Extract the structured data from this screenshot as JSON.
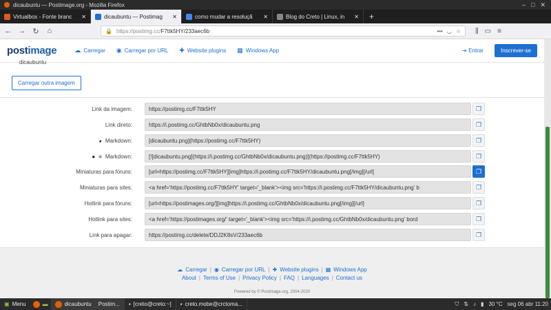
{
  "window": {
    "title": "dicaubuntu — Postimage.org - Mozilla Firefox",
    "controls": [
      "–",
      "□",
      "✕"
    ]
  },
  "tabs": [
    {
      "label": "Virtualbox - Fonte branc",
      "color": "#e05a1b",
      "active": false
    },
    {
      "label": "dicaubuntu — Postimag",
      "color": "#1d6fd1",
      "active": true
    },
    {
      "label": "como mudar a resoluçã",
      "color": "#4285f4",
      "active": false
    },
    {
      "label": "Blog do Creto | Linux, in",
      "color": "#888888",
      "active": false
    }
  ],
  "newtab_glyph": "+",
  "nav": {
    "back": "←",
    "forward": "→",
    "reload": "↻",
    "home": "⌂",
    "url_prefix": "https://postimg.cc/",
    "url_path": "F7ttk5HY/233aec6b"
  },
  "header": {
    "logo_a": "post",
    "logo_b": "image",
    "nav": [
      {
        "label": "Carregar",
        "icon": "cloud-upload-icon",
        "glyph": "☁"
      },
      {
        "label": "Carregar por URL",
        "icon": "globe-icon",
        "glyph": "◉"
      },
      {
        "label": "Website plugins",
        "icon": "puzzle-icon",
        "glyph": "✚"
      },
      {
        "label": "Windows App",
        "icon": "windows-icon",
        "glyph": "▦"
      }
    ],
    "login": "Entrar",
    "signup": "Inscrever-se"
  },
  "content": {
    "filename": "dicaubuntu",
    "upload_more": "Carregar outra imagem"
  },
  "links": [
    {
      "label": "Link da imagem:",
      "value": "https://postimg.cc/F7ttk5HY"
    },
    {
      "label": "Link direto:",
      "value": "https://i.postimg.cc/GhtbNb0x/dicaubuntu.png"
    },
    {
      "label": "Markdown:",
      "value": "[dicaubuntu.png](https://postimg.cc/F7ttk5HY)"
    },
    {
      "label": "Markdown:",
      "value": "[![dicaubuntu.png](https://i.postimg.cc/GhtbNb0x/dicaubuntu.png)](https://postimg.cc/F7ttk5HY)"
    },
    {
      "label": "Miniaturas para fóruns:",
      "value": "[url=https://postimg.cc/F7ttk5HY][img]https://i.postimg.cc/F7ttk5HY/dicaubuntu.png[/img][/url]"
    },
    {
      "label": "Miniaturas para sites:",
      "value": "<a href='https://postimg.cc/F7ttk5HY' target='_blank'><img src='https://i.postimg.cc/F7ttk5HY/dicaubuntu.png' b"
    },
    {
      "label": "Hotlink para fóruns:",
      "value": "[url=https://postimages.org/][img]https://i.postimg.cc/GhtbNb0x/dicaubuntu.png[/img][/url]"
    },
    {
      "label": "Hotlink para sites:",
      "value": "<a href='https://postimages.org/' target='_blank'><img src='https://i.postimg.cc/GhtbNb0x/dicaubuntu.png' bord"
    },
    {
      "label": "Link para apagar:",
      "value": "https://postimg.cc/delete/DDJ2K8sV/233aec6b"
    }
  ],
  "footer": {
    "row1": [
      "Carregar",
      "Carregar por URL",
      "Website plugins",
      "Windows App"
    ],
    "row2": [
      "About",
      "Terms of Use",
      "Privacy Policy",
      "FAQ",
      "Languages",
      "Contact us"
    ],
    "powered": "Powered by © Postimage.org, 2004-2020"
  },
  "taskbar": {
    "menu": "Menu",
    "tasks": [
      "dicaubuntu",
      "Postim...",
      "[creto@creto:~]",
      "creto.mobe@crctoma..."
    ],
    "temp": "30 °C",
    "clock": "seg 06 abr 11:20"
  },
  "colors": {
    "accent": "#1d6fd1",
    "scroll_thumb": "#3d8b3d"
  }
}
